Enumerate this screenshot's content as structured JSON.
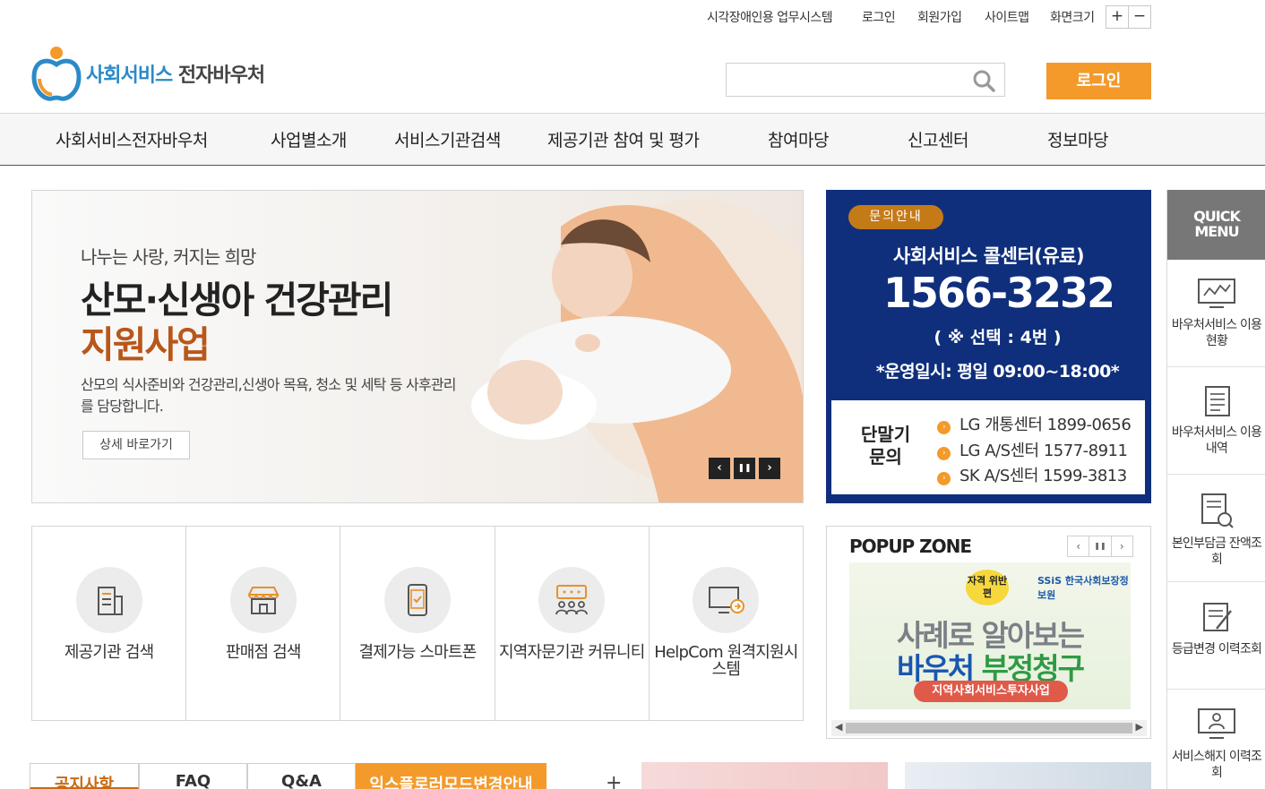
{
  "util_links": [
    "시각장애인용 업무시스템",
    "로그인",
    "회원가입",
    "사이트맵",
    "화면크기"
  ],
  "zoom": {
    "plus": "+",
    "minus": "−"
  },
  "logo": {
    "part1": "사회서비스",
    "part2": "전자바우처"
  },
  "search": {
    "placeholder": ""
  },
  "login_button": "로그인",
  "gnb": [
    "사회서비스전자바우처",
    "사업별소개",
    "서비스기관검색",
    "제공기관 참여 및 평가",
    "참여마당",
    "신고센터",
    "정보마당"
  ],
  "banner": {
    "subtitle": "나누는 사랑, 커지는 희망",
    "title1": "산모·신생아 건강관리",
    "title2": "지원사업",
    "desc": "산모의 식사준비와 건강관리,신생아 목욕, 청소 및 세탁 등 사후관리를 담당합니다.",
    "more": "상세 바로가기",
    "prev": "‹",
    "pause": "❚❚",
    "next": "›"
  },
  "contact": {
    "badge": "문의안내",
    "title": "사회서비스 콜센터(유료)",
    "phone": "1566-3232",
    "option": "( ※ 선택 : 4번 )",
    "hours": "*운영일시: 평일 09:00~18:00*",
    "terminal_label": "단말기 문의",
    "lines": [
      "LG 개통센터 1899-0656",
      "LG A/S센터 1577-8911",
      "SK A/S센터 1599-3813"
    ],
    "accent": "#0f2f7c"
  },
  "quick": {
    "title": "QUICK MENU",
    "items": [
      "바우처서비스 이용현황",
      "바우처서비스 이용내역",
      "본인부담금 잔액조회",
      "등급변경 이력조회",
      "서비스해지 이력조회"
    ]
  },
  "icon_menu": [
    {
      "label": "제공기관 검색",
      "icon": "building-icon"
    },
    {
      "label": "판매점 검색",
      "icon": "store-icon"
    },
    {
      "label": "결제가능 스마트폰",
      "icon": "smartphone-icon"
    },
    {
      "label": "지역자문기관 커뮤니티",
      "icon": "community-icon"
    },
    {
      "label": "HelpCom 원격지원시스템",
      "icon": "monitor-icon"
    }
  ],
  "popup": {
    "title": "POPUP ZONE",
    "prev": "‹",
    "pause": "❚❚",
    "next": "›",
    "badge": "자격 위반편",
    "ssis": "SSiS 한국사회보장정보원",
    "line1": "사례로 알아보는",
    "line2a": "바우처",
    "line2b": "부정청구",
    "tag": "지역사회서비스투자사업"
  },
  "tabs": [
    "공지사항",
    "FAQ",
    "Q&A",
    "익스플로러모드변경안내"
  ],
  "tabs_more": "+"
}
